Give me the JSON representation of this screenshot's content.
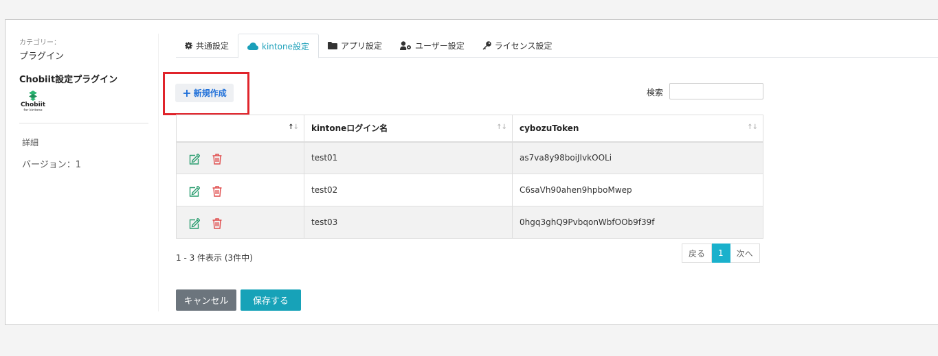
{
  "sidebar": {
    "category_label": "カテゴリー：",
    "category_value": "プラグイン",
    "plugin_name": "Chobiit設定プラグイン",
    "logo_text": "Chobiit",
    "logo_subtext": "for kintone",
    "detail_label": "詳細",
    "version": "バージョン：1"
  },
  "tabs": [
    {
      "label": "共通設定",
      "icon": "gear-icon",
      "active": false
    },
    {
      "label": "kintone設定",
      "icon": "cloud-icon",
      "active": true
    },
    {
      "label": "アプリ設定",
      "icon": "folder-icon",
      "active": false
    },
    {
      "label": "ユーザー設定",
      "icon": "user-cog-icon",
      "active": false
    },
    {
      "label": "ライセンス設定",
      "icon": "key-icon",
      "active": false
    }
  ],
  "toolbar": {
    "new_label": "新規作成",
    "search_label": "検索",
    "search_value": ""
  },
  "table": {
    "columns": [
      "",
      "kintoneログイン名",
      "cybozuToken"
    ],
    "rows": [
      {
        "login": "test01",
        "token": "as7va8y98boiJIvkOOLi"
      },
      {
        "login": "test02",
        "token": "C6saVh90ahen9hpboMwep"
      },
      {
        "login": "test03",
        "token": "0hgq3ghQ9PvbqonWbfOOb9f39f"
      }
    ]
  },
  "footer": {
    "info": "1 - 3 件表示 (3件中)",
    "prev": "戻る",
    "page": "1",
    "next": "次へ"
  },
  "actions": {
    "cancel": "キャンセル",
    "save": "保存する"
  },
  "colors": {
    "accent": "#17a2b8",
    "link": "#1e6fd9",
    "edit_icon": "#2a9d6f",
    "delete_icon": "#e04a4a",
    "highlight": "#e0242b"
  }
}
